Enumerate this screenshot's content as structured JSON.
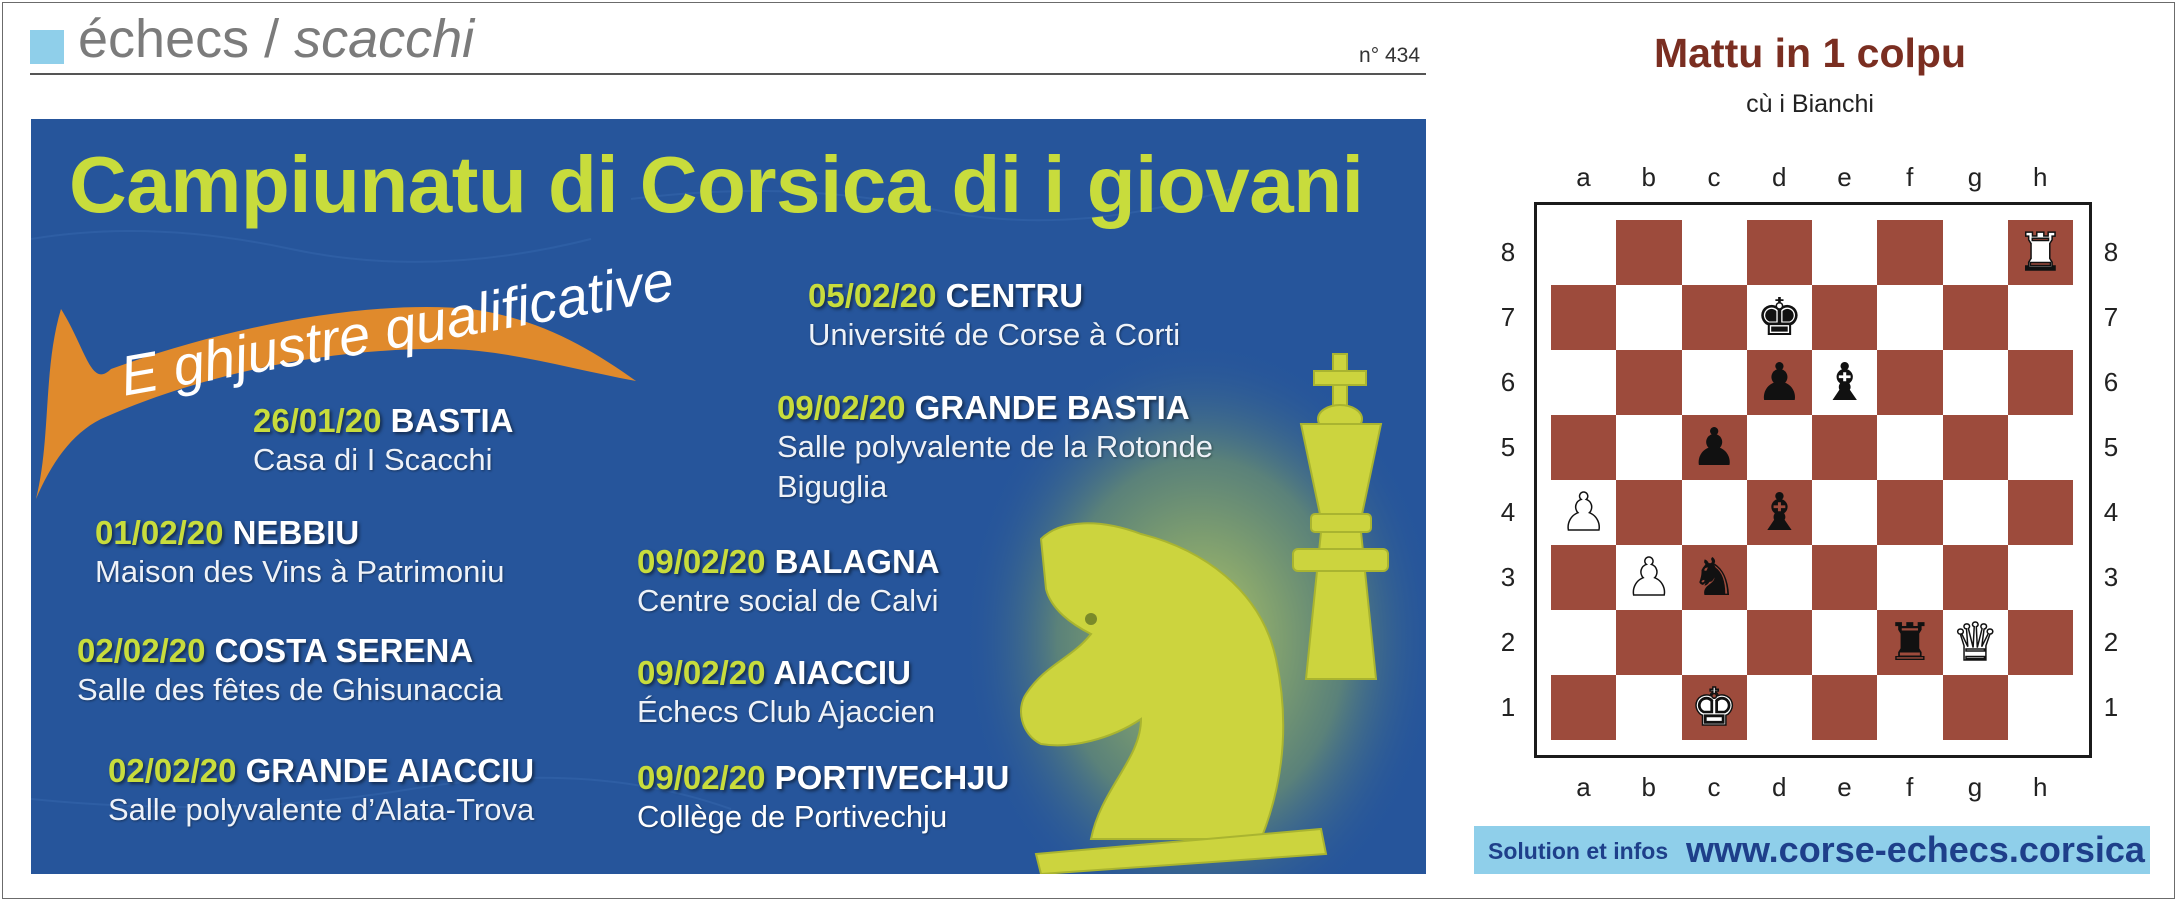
{
  "header": {
    "title_main": "échecs / ",
    "title_italic": "scacchi",
    "number": "n° 434",
    "accent_color": "#8fcfea"
  },
  "poster": {
    "title": "Campiunatu di Corsica di i giovani",
    "subtitle": "E ghjustre qualificative",
    "events": [
      {
        "date": "26/01/20",
        "name": "BASTIA",
        "location": "Casa di I Scacchi"
      },
      {
        "date": "01/02/20",
        "name": "NEBBIU",
        "location": "Maison des Vins à Patrimoniu"
      },
      {
        "date": "02/02/20",
        "name": "COSTA SERENA",
        "location": "Salle des fêtes de Ghisunaccia"
      },
      {
        "date": "02/02/20",
        "name": "GRANDE AIACCIU",
        "location": "Salle polyvalente d’Alata-Trova"
      },
      {
        "date": "05/02/20",
        "name": "CENTRU",
        "location": "Université de Corse à Corti"
      },
      {
        "date": "09/02/20",
        "name": "GRANDE BASTIA",
        "location": "Salle polyvalente de la Rotonde",
        "location2": "Biguglia"
      },
      {
        "date": "09/02/20",
        "name": "BALAGNA",
        "location": "Centre social de Calvi"
      },
      {
        "date": "09/02/20",
        "name": "AIACCIU",
        "location": "Échecs Club Ajaccien"
      },
      {
        "date": "09/02/20",
        "name": "PORTIVECHJU",
        "location": "Collège de Portivechju"
      }
    ],
    "colors": {
      "background": "#26559b",
      "accent": "#c8dc3c",
      "brush": "#e08a2c"
    }
  },
  "puzzle": {
    "title": "Mattu in 1 colpu",
    "subtitle": "cù i Bianchi",
    "files": [
      "a",
      "b",
      "c",
      "d",
      "e",
      "f",
      "g",
      "h"
    ],
    "ranks": [
      "8",
      "7",
      "6",
      "5",
      "4",
      "3",
      "2",
      "1"
    ],
    "pieces": {
      "h8": "white-rook",
      "d7": "black-king",
      "d6": "black-pawn",
      "e6": "black-bishop",
      "c5": "black-pawn",
      "a4": "white-pawn",
      "d4": "black-bishop",
      "b3": "white-pawn",
      "c3": "black-knight",
      "f2": "black-rook",
      "g2": "white-queen",
      "c1": "white-king"
    },
    "colors": {
      "dark_square": "#9d4b3c",
      "light_square": "#ffffff"
    },
    "solution_label": "Solution et infos",
    "solution_url": "www.corse-echecs.corsica"
  }
}
